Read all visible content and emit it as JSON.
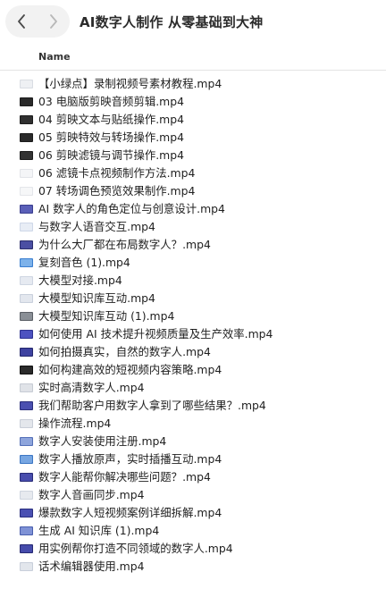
{
  "window": {
    "title": "AI数字人制作 从零基础到大神",
    "back_icon": "chevron-left-icon",
    "forward_icon": "chevron-right-icon"
  },
  "columns": {
    "name": "Name"
  },
  "files": [
    {
      "name": "【小绿点】录制视频号素材教程.mp4",
      "thumb": "#d9dde3",
      "inner": "#eef0f3"
    },
    {
      "name": "03 电脑版剪映音频剪辑.mp4",
      "thumb": "#1c1c1c",
      "inner": "#2a2a2a"
    },
    {
      "name": "04 剪映文本与贴纸操作.mp4",
      "thumb": "#1c1c1c",
      "inner": "#303030"
    },
    {
      "name": "05 剪映特效与转场操作.mp4",
      "thumb": "#1c1c1c",
      "inner": "#2a2a2a"
    },
    {
      "name": "06 剪映滤镜与调节操作.mp4",
      "thumb": "#1c1c1c",
      "inner": "#333333"
    },
    {
      "name": "06 滤镜卡点视频制作方法.mp4",
      "thumb": "#e2e4e8",
      "inner": "#f4f5f7"
    },
    {
      "name": "07 转场调色预览效果制作.mp4",
      "thumb": "#e4e6ea",
      "inner": "#f6f7f8"
    },
    {
      "name": "AI 数字人的角色定位与创意设计.mp4",
      "thumb": "#3b3f8f",
      "inner": "#5a5fb8"
    },
    {
      "name": "与数字人语音交互.mp4",
      "thumb": "#cfd8e8",
      "inner": "#e8edf5"
    },
    {
      "name": "为什么大厂都在布局数字人？.mp4",
      "thumb": "#2d2f6e",
      "inner": "#4b4fa3"
    },
    {
      "name": "复刻音色 (1).mp4",
      "thumb": "#3a7fd0",
      "inner": "#7db2ea"
    },
    {
      "name": "大模型对接.mp4",
      "thumb": "#cfd6e2",
      "inner": "#e6eaf1"
    },
    {
      "name": "大模型知识库互动.mp4",
      "thumb": "#c9d0dc",
      "inner": "#e3e7ee"
    },
    {
      "name": "大模型知识库互动 (1).mp4",
      "thumb": "#5b5f66",
      "inner": "#8a8f96"
    },
    {
      "name": "如何使用 AI 技术提升视频质量及生产效率.mp4",
      "thumb": "#2f3392",
      "inner": "#4d52c0"
    },
    {
      "name": "如何拍摄真实，自然的数字人.mp4",
      "thumb": "#25286d",
      "inner": "#3e42a0"
    },
    {
      "name": "如何构建高效的短视频内容策略.mp4",
      "thumb": "#111111",
      "inner": "#2b2b2b"
    },
    {
      "name": "实时高清数字人.mp4",
      "thumb": "#c7ccd4",
      "inner": "#e0e3e8"
    },
    {
      "name": "我们帮助客户用数字人拿到了哪些结果？.mp4",
      "thumb": "#2a2e7c",
      "inner": "#4a4fb0"
    },
    {
      "name": "操作流程.mp4",
      "thumb": "#c9ced8",
      "inner": "#e4e7ec"
    },
    {
      "name": "数字人安装使用注册.mp4",
      "thumb": "#5470b8",
      "inner": "#8ea5dc"
    },
    {
      "name": "数字人播放原声，实时插播互动.mp4",
      "thumb": "#3d77c4",
      "inner": "#77a6e2"
    },
    {
      "name": "数字人能帮你解决哪些问题？.mp4",
      "thumb": "#292c78",
      "inner": "#484dad"
    },
    {
      "name": "数字人音画同步.mp4",
      "thumb": "#cfd5df",
      "inner": "#e7eaef"
    },
    {
      "name": "爆款数字人短视频案例详细拆解.mp4",
      "thumb": "#2b2f7f",
      "inner": "#4a50b2"
    },
    {
      "name": "生成 AI 知识库 (1).mp4",
      "thumb": "#4a5fae",
      "inner": "#7f92d6"
    },
    {
      "name": "用实例帮你打造不同领域的数字人.mp4",
      "thumb": "#272a74",
      "inner": "#464bab"
    },
    {
      "name": "话术编辑器使用.mp4",
      "thumb": "#c8cfda",
      "inner": "#e2e6ec"
    }
  ],
  "file_icon": "video-file-icon"
}
